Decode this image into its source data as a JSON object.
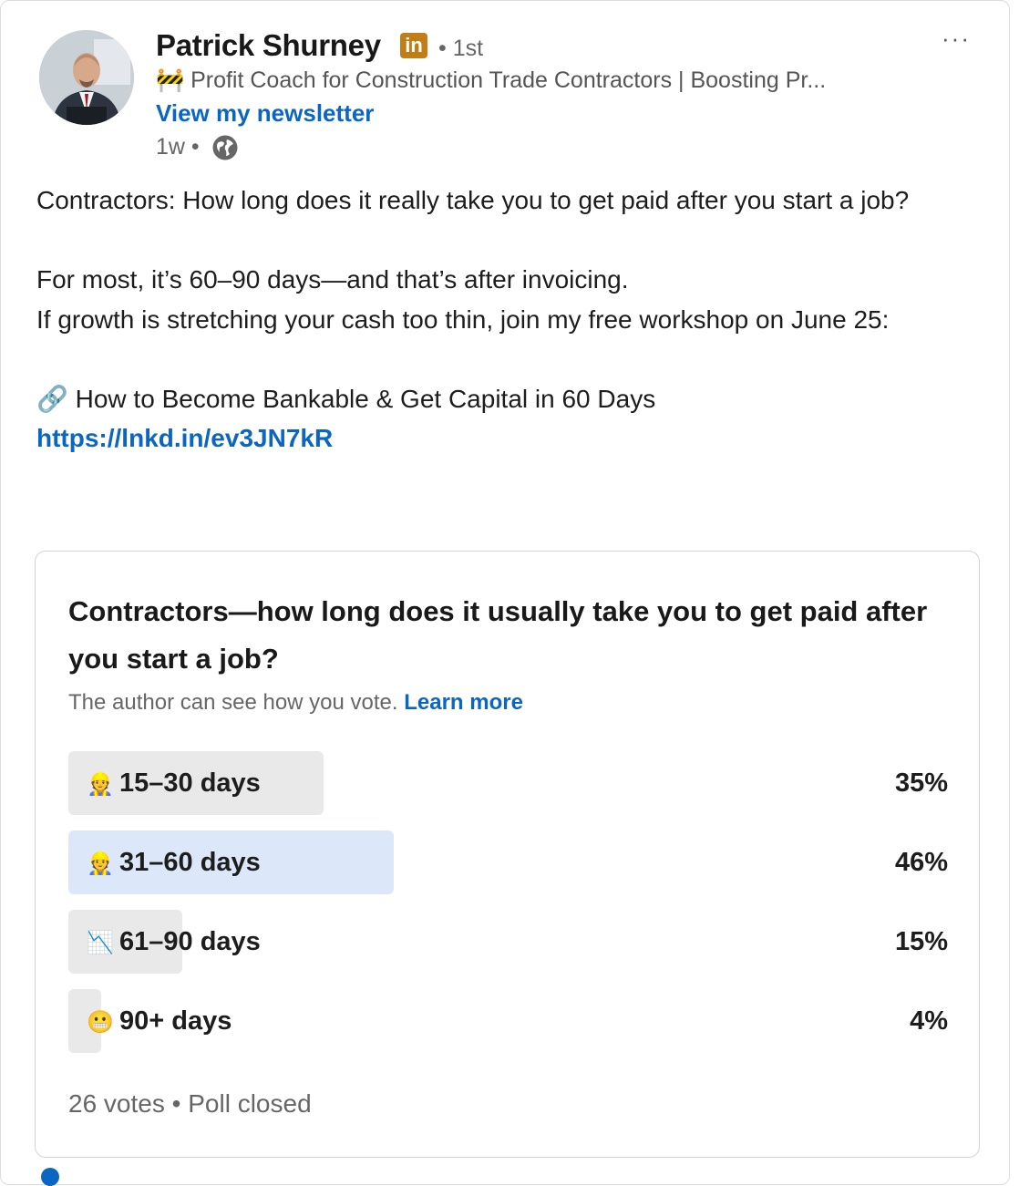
{
  "author": {
    "name": "Patrick Shurney",
    "badge": "in",
    "degree": "• 1st",
    "headline": "🚧 Profit Coach for Construction Trade Contractors | Boosting Pr...",
    "newsletter_label": "View my newsletter",
    "time": "1w •",
    "visibility_icon": "globe-icon"
  },
  "menu": {
    "more_label": "···"
  },
  "post": {
    "p1": "Contractors: How long does it really take you to get paid after you start a job?",
    "p2a": "For most, it’s 60–90 days—and that’s after invoicing.",
    "p2b": "If growth is stretching your cash too thin, join my free workshop on June 25:",
    "p3": "🔗 How to Become Bankable & Get Capital in 60 Days",
    "link": "https://lnkd.in/ev3JN7kR"
  },
  "poll": {
    "question": "Contractors—how long does it usually take you to get paid after you start a job?",
    "note": "The author can see how you vote.",
    "learn_more": "Learn more",
    "options": [
      {
        "emoji": "👷",
        "label": "15–30 days",
        "percent_text": "35%",
        "fill_fraction": 0.29,
        "selected": false
      },
      {
        "emoji": "👷",
        "label": "31–60 days",
        "percent_text": "46%",
        "fill_fraction": 0.37,
        "selected": true
      },
      {
        "emoji": "📉",
        "label": "61–90 days",
        "percent_text": "15%",
        "fill_fraction": 0.13,
        "selected": false
      },
      {
        "emoji": "😬",
        "label": "90+ days",
        "percent_text": "4%",
        "fill_fraction": 0.035,
        "selected": false
      }
    ],
    "votes": "26 votes",
    "status": "Poll closed"
  },
  "colors": {
    "link_blue": "#0a66c2",
    "selected_fill": "#dce8fa",
    "option_fill": "#e9e9e9",
    "badge_gold": "#c37d16"
  }
}
